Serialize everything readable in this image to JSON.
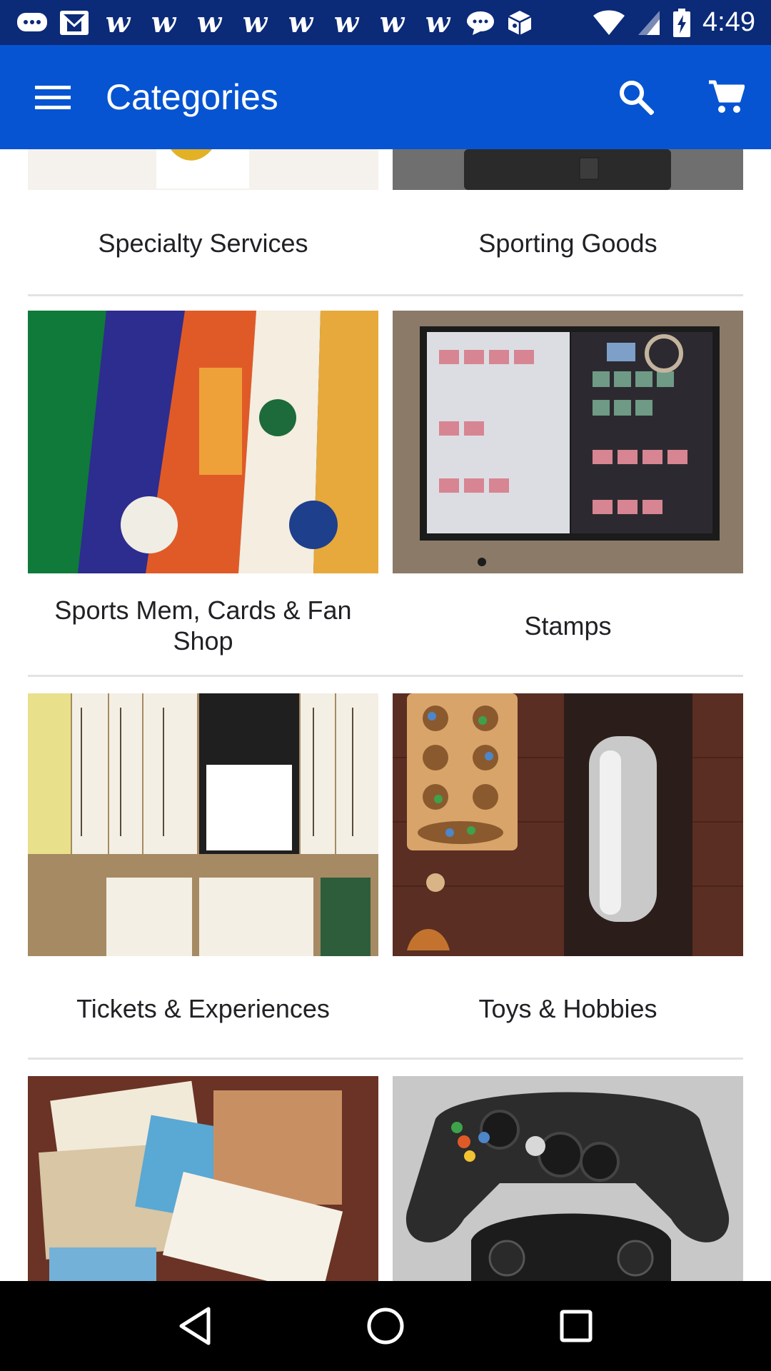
{
  "status_bar": {
    "time": "4:49",
    "icons": [
      "messages-icon",
      "gmail-icon",
      "w-icon",
      "w-icon",
      "w-icon",
      "w-icon",
      "w-icon",
      "w-icon",
      "w-icon",
      "w-icon",
      "chat-bubble-icon",
      "box-icon"
    ],
    "w_glyph": "w"
  },
  "app_bar": {
    "title": "Categories",
    "background": "#0654d2"
  },
  "categories": [
    {
      "left": "Specialty Services",
      "right": "Sporting Goods"
    },
    {
      "left": "Sports Mem, Cards & Fan Shop",
      "right": "Stamps"
    },
    {
      "left": "Tickets & Experiences",
      "right": "Toys & Hobbies"
    },
    {
      "left": "",
      "right": ""
    }
  ],
  "colors": {
    "status_bar": "#0b2a78",
    "app_bar": "#0654d2",
    "nav_bar": "#000000",
    "divider": "#e3e3e3"
  }
}
